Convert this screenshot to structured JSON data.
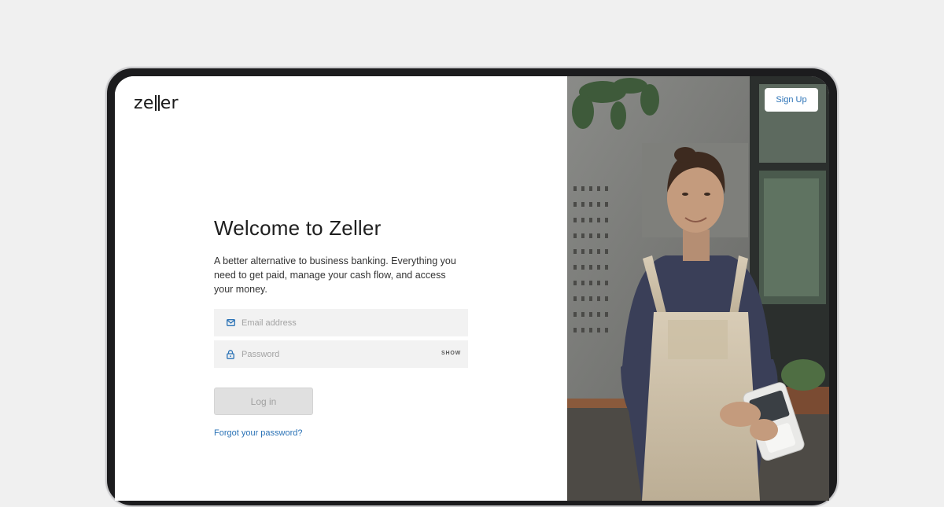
{
  "brand": {
    "logo_text_a": "ze",
    "logo_text_b": "er"
  },
  "header": {
    "signup_label": "Sign Up"
  },
  "login": {
    "title": "Welcome to Zeller",
    "description": "A better alternative to business banking. Everything you need to get paid, manage your cash flow, and access your money.",
    "email": {
      "placeholder": "Email address",
      "value": ""
    },
    "password": {
      "placeholder": "Password",
      "value": "",
      "toggle_label": "SHOW"
    },
    "login_label": "Log in",
    "forgot_label": "Forgot your password?"
  },
  "icons": {
    "email": "mail-icon",
    "password": "lock-icon"
  },
  "colors": {
    "accent": "#2a72b6",
    "field_bg": "#f2f2f2",
    "button_disabled": "#e0e0e0",
    "page_bg": "#f0f0f0"
  }
}
